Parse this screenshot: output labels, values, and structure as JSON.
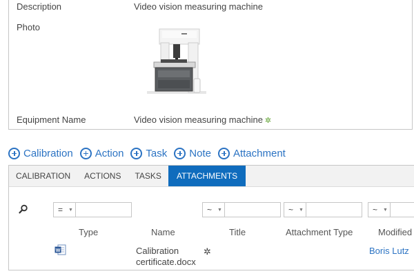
{
  "details": {
    "description_label": "Description",
    "description_value": "Video vision measuring machine",
    "photo_label": "Photo",
    "equipment_name_label": "Equipment Name",
    "equipment_name_value": "Video vision measuring machine",
    "new_marker": "✲"
  },
  "actions": [
    {
      "label": "Calibration"
    },
    {
      "label": "Action"
    },
    {
      "label": "Task"
    },
    {
      "label": "Note"
    },
    {
      "label": "Attachment"
    }
  ],
  "tabs": [
    {
      "label": "CALIBRATION",
      "active": false
    },
    {
      "label": "ACTIONS",
      "active": false
    },
    {
      "label": "TASKS",
      "active": false
    },
    {
      "label": "ATTACHMENTS",
      "active": true
    }
  ],
  "filters": {
    "type_operator": "=",
    "title_operator": "~",
    "attachment_type_operator": "~",
    "modified_operator": "~"
  },
  "columns": {
    "type": "Type",
    "name": "Name",
    "title": "Title",
    "attachment_type": "Attachment Type",
    "modified": "Modified"
  },
  "rows": [
    {
      "file_icon": "word-document-icon",
      "name_line1": "Calibration",
      "name_line2": "certificate.docx",
      "new_marker": "✲",
      "modified_by": "Boris Lutz"
    }
  ],
  "colors": {
    "accent": "#0f6cbd",
    "link": "#2b73c3",
    "new_marker": "#5a9e2b"
  }
}
